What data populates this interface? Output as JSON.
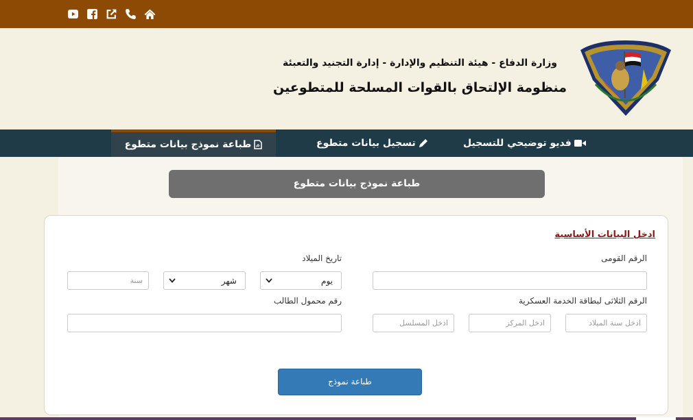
{
  "topbar": {
    "icons": [
      "youtube-icon",
      "facebook-icon",
      "external-link-icon",
      "phone-icon",
      "home-icon"
    ]
  },
  "header": {
    "subtitle": "وزارة الدفاع - هيئة التنظيم والإدارة - إدارة التجنيد والتعبئة",
    "title": "منظومة الإلتحاق بالقوات المسلحة للمتطوعين"
  },
  "nav": {
    "video": "فديو توضيحي للتسجيل",
    "register": "تسجيل بيانات متطوع",
    "print": "طباعة نموذج بيانات متطوع"
  },
  "banner": "طباعة نموذج بيانات متطوع",
  "form": {
    "section_title": "ادخل البيانات الأساسية",
    "national_id_label": "الرقم القومى",
    "birth_date_label": "تاريخ الميلاد",
    "day_value": "يوم",
    "month_value": "شهر",
    "year_placeholder": "سنة",
    "military_card_label": "الرقم الثلاثى لبطاقة الخدمة العسكرية",
    "birth_year_placeholder": "ادخل سنة الميلاد",
    "center_placeholder": "ادخل المركز",
    "serial_placeholder": "ادخل المسلسل",
    "mobile_label": "رقم محمول الطالب",
    "submit_label": "طباعة نموذج"
  },
  "colors": {
    "topbar": "#8c4a05",
    "nav": "#1f3b47",
    "banner": "#6f6f6f",
    "section_title": "#8b1818",
    "submit": "#337ab7"
  }
}
